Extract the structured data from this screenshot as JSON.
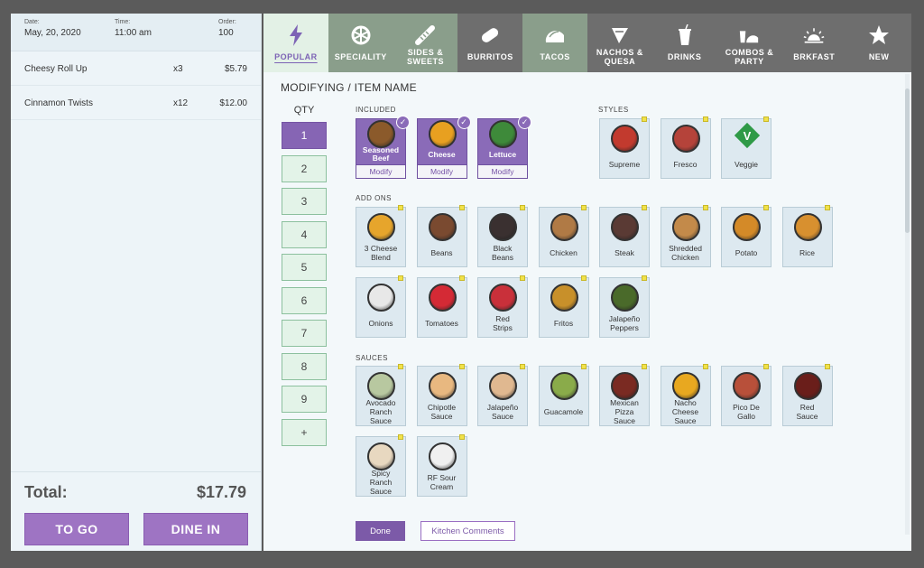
{
  "order": {
    "date_label": "Date:",
    "date": "May, 20, 2020",
    "time_label": "Time:",
    "time": "11:00 am",
    "order_label": "Order:",
    "order_number": "100",
    "items": [
      {
        "name": "Cheesy Roll Up",
        "qty": "x3",
        "price": "$5.79"
      },
      {
        "name": "Cinnamon Twists",
        "qty": "x12",
        "price": "$12.00"
      }
    ],
    "total_label": "Total:",
    "total": "$17.79",
    "to_go_label": "TO GO",
    "dine_in_label": "DINE IN"
  },
  "categories": [
    {
      "label": "POPULAR",
      "icon": "lightning-icon",
      "state": "selected"
    },
    {
      "label": "SPECIALITY",
      "icon": "specialty-icon",
      "state": "green"
    },
    {
      "label": "SIDES &\nSWEETS",
      "icon": "cinnamon-twist-icon",
      "state": "green"
    },
    {
      "label": "BURRITOS",
      "icon": "burrito-icon",
      "state": "dark"
    },
    {
      "label": "TACOS",
      "icon": "taco-icon",
      "state": "green"
    },
    {
      "label": "NACHOS &\nQUESA",
      "icon": "nachos-icon",
      "state": "dark"
    },
    {
      "label": "DRINKS",
      "icon": "drink-cup-icon",
      "state": "dark"
    },
    {
      "label": "COMBOS &\nPARTY",
      "icon": "combo-icon",
      "state": "dark"
    },
    {
      "label": "BRKFAST",
      "icon": "sunrise-icon",
      "state": "dark"
    },
    {
      "label": "NEW",
      "icon": "star-icon",
      "state": "dark"
    }
  ],
  "main": {
    "title": "MODIFYING / ITEM NAME",
    "qty_label": "QTY",
    "qty_options": [
      "1",
      "2",
      "3",
      "4",
      "5",
      "6",
      "7",
      "8",
      "9",
      "+"
    ],
    "qty_selected": "1",
    "included_label": "INCLUDED",
    "styles_label": "STYLES",
    "add_ons_label": "ADD ONS",
    "sauces_label": "SAUCES",
    "modify_label": "Modify",
    "included": [
      {
        "label": "Seasoned\nBeef",
        "color": "#8b5a2b"
      },
      {
        "label": "Cheese",
        "color": "#e8a020"
      },
      {
        "label": "Lettuce",
        "color": "#3e8a3a"
      }
    ],
    "styles": [
      {
        "label": "Supreme",
        "color": "#c23a2e"
      },
      {
        "label": "Fresco",
        "color": "#b5433a"
      },
      {
        "label": "Veggie",
        "color": "#2f9a47",
        "badge": "V"
      }
    ],
    "add_ons": [
      {
        "label": "3 Cheese\nBlend",
        "color": "#e6a52c"
      },
      {
        "label": "Beans",
        "color": "#7a4a30"
      },
      {
        "label": "Black\nBeans",
        "color": "#3a3030"
      },
      {
        "label": "Chicken",
        "color": "#b07a45"
      },
      {
        "label": "Steak",
        "color": "#5a3a34"
      },
      {
        "label": "Shredded\nChicken",
        "color": "#c38a4a"
      },
      {
        "label": "Potato",
        "color": "#d48a28"
      },
      {
        "label": "Rice",
        "color": "#d8902f"
      },
      {
        "label": "Onions",
        "color": "#e8e8e8"
      },
      {
        "label": "Tomatoes",
        "color": "#d42a35"
      },
      {
        "label": "Red\nStrips",
        "color": "#c9303a"
      },
      {
        "label": "Fritos",
        "color": "#c8902a"
      },
      {
        "label": "Jalapeño\nPeppers",
        "color": "#4a6a2a"
      }
    ],
    "sauces": [
      {
        "label": "Avocado\nRanch\nSauce",
        "color": "#b8c8a0"
      },
      {
        "label": "Chipotle\nSauce",
        "color": "#e8b880"
      },
      {
        "label": "Jalapeño\nSauce",
        "color": "#e0b890"
      },
      {
        "label": "Guacamole",
        "color": "#8aab4a"
      },
      {
        "label": "Mexican\nPizza\nSauce",
        "color": "#7a2a22"
      },
      {
        "label": "Nacho\nCheese\nSauce",
        "color": "#e8a820"
      },
      {
        "label": "Pico De\nGallo",
        "color": "#b8503a"
      },
      {
        "label": "Red\nSauce",
        "color": "#6a1e1a"
      },
      {
        "label": "Spicy\nRanch\nSauce",
        "color": "#e8d8c0"
      },
      {
        "label": "RF Sour\nCream",
        "color": "#f0f0f0"
      }
    ],
    "done_label": "Done",
    "kitchen_comments_label": "Kitchen Comments"
  }
}
